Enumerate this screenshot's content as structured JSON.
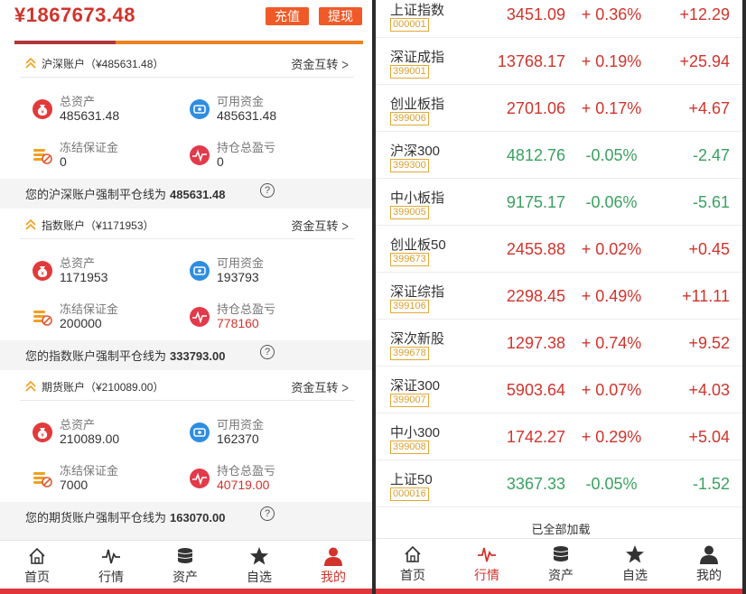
{
  "header": {
    "total_amount": "¥1867673.48",
    "recharge_label": "充值",
    "withdraw_label": "提现",
    "progress_fraction": 0.29
  },
  "sections": [
    {
      "title": "沪深账户（¥485631.48）",
      "transfer_label": "资金互转",
      "total_assets_label": "总资产",
      "total_assets": "485631.48",
      "available_label": "可用资金",
      "available": "485631.48",
      "frozen_label": "冻结保证金",
      "frozen": "0",
      "pnl_label": "持仓总盈亏",
      "pnl": "0",
      "liquidation_label": "您的沪深账户强制平仓线为",
      "liquidation_value": "485631.48"
    },
    {
      "title": "指数账户（¥1171953）",
      "transfer_label": "资金互转",
      "total_assets_label": "总资产",
      "total_assets": "1171953",
      "available_label": "可用资金",
      "available": "193793",
      "frozen_label": "冻结保证金",
      "frozen": "200000",
      "pnl_label": "持仓总盈亏",
      "pnl": "778160",
      "liquidation_label": "您的指数账户强制平仓线为",
      "liquidation_value": "333793.00"
    },
    {
      "title": "期货账户（¥210089.00）",
      "transfer_label": "资金互转",
      "total_assets_label": "总资产",
      "total_assets": "210089.00",
      "available_label": "可用资金",
      "available": "162370",
      "frozen_label": "冻结保证金",
      "frozen": "7000",
      "pnl_label": "持仓总盈亏",
      "pnl": "40719.00",
      "liquidation_label": "您的期货账户强制平仓线为",
      "liquidation_value": "163070.00"
    }
  ],
  "qmark": "?",
  "left_tabs": [
    {
      "label": "首页",
      "icon": "home-icon"
    },
    {
      "label": "行情",
      "icon": "pulse-icon"
    },
    {
      "label": "资产",
      "icon": "coins-icon"
    },
    {
      "label": "自选",
      "icon": "star-icon"
    },
    {
      "label": "我的",
      "icon": "user-icon"
    }
  ],
  "left_active_tab": 4,
  "market": {
    "top_partial": {
      "name": "上证指数",
      "code": "000001",
      "price": "3451.09",
      "pct": "+ 0.36%",
      "chg": "+12.29",
      "dir": "up"
    },
    "rows": [
      {
        "name": "深证成指",
        "code": "399001",
        "price": "13768.17",
        "pct": "+ 0.19%",
        "chg": "+25.94",
        "dir": "up"
      },
      {
        "name": "创业板指",
        "code": "399006",
        "price": "2701.06",
        "pct": "+ 0.17%",
        "chg": "+4.67",
        "dir": "up"
      },
      {
        "name": "沪深300",
        "code": "399300",
        "price": "4812.76",
        "pct": "-0.05%",
        "chg": "-2.47",
        "dir": "down"
      },
      {
        "name": "中小板指",
        "code": "399005",
        "price": "9175.17",
        "pct": "-0.06%",
        "chg": "-5.61",
        "dir": "down"
      },
      {
        "name": "创业板50",
        "code": "399673",
        "price": "2455.88",
        "pct": "+ 0.02%",
        "chg": "+0.45",
        "dir": "up"
      },
      {
        "name": "深证综指",
        "code": "399106",
        "price": "2298.45",
        "pct": "+ 0.49%",
        "chg": "+11.11",
        "dir": "up"
      },
      {
        "name": "深次新股",
        "code": "399678",
        "price": "1297.38",
        "pct": "+ 0.74%",
        "chg": "+9.52",
        "dir": "up"
      },
      {
        "name": "深证300",
        "code": "399007",
        "price": "5903.64",
        "pct": "+ 0.07%",
        "chg": "+4.03",
        "dir": "up"
      },
      {
        "name": "中小300",
        "code": "399008",
        "price": "1742.27",
        "pct": "+ 0.29%",
        "chg": "+5.04",
        "dir": "up"
      },
      {
        "name": "上证50",
        "code": "000016",
        "price": "3367.33",
        "pct": "-0.05%",
        "chg": "-1.52",
        "dir": "down"
      }
    ],
    "loaded_text": "已全部加载"
  },
  "right_tabs": [
    {
      "label": "首页",
      "icon": "home-icon"
    },
    {
      "label": "行情",
      "icon": "pulse-icon"
    },
    {
      "label": "资产",
      "icon": "coins-icon"
    },
    {
      "label": "自选",
      "icon": "star-icon"
    },
    {
      "label": "我的",
      "icon": "user-icon"
    }
  ],
  "right_active_tab": 1,
  "colors": {
    "up": "#d0342c",
    "down": "#3aa060",
    "accent": "#f05a28",
    "code_border": "#e0a838"
  }
}
